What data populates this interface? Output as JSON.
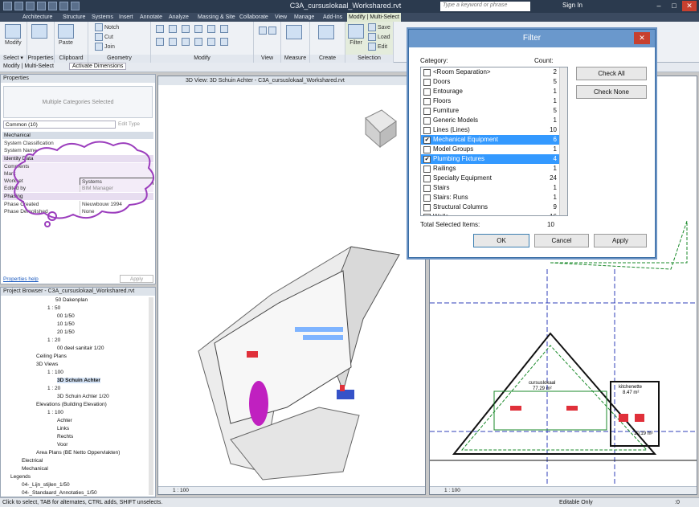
{
  "app": {
    "title": "C3A_cursuslokaal_Workshared.rvt",
    "search_placeholder": "Type a keyword or phrase",
    "signin": "Sign In"
  },
  "ribbon_tabs": [
    "Architecture",
    "Structure",
    "Systems",
    "Insert",
    "Annotate",
    "Analyze",
    "Massing & Site",
    "Collaborate",
    "View",
    "Manage",
    "Add-Ins",
    "Modify | Multi-Select"
  ],
  "ribbon": {
    "modify": "Modify",
    "paste": "Paste",
    "notch": "Notch",
    "cut": "Cut",
    "join": "Join",
    "filter": "Filter",
    "save": "Save",
    "load": "Load",
    "edit": "Edit",
    "groups": {
      "select": "Select",
      "properties": "Properties",
      "clipboard": "Clipboard",
      "geometry": "Geometry",
      "modify": "Modify",
      "view": "View",
      "measure": "Measure",
      "create": "Create",
      "selection": "Selection"
    },
    "select_dropdown": "Select ▾"
  },
  "context": {
    "label": "Modify | Multi-Select",
    "activate": "Activate Dimensions"
  },
  "properties": {
    "header": "Properties",
    "type_selector": "Multiple Categories Selected",
    "filter_value": "Common (10)",
    "edit_type": "Edit Type",
    "sections": {
      "mechanical": "Mechanical",
      "identity": "Identity Data",
      "phasing": "Phasing"
    },
    "rows": [
      {
        "k": "System Classification",
        "v": ""
      },
      {
        "k": "System Name",
        "v": ""
      },
      {
        "k": "Comments",
        "v": ""
      },
      {
        "k": "Mark",
        "v": ""
      },
      {
        "k": "Workset",
        "v": "Systems"
      },
      {
        "k": "Edited by",
        "v": "BIM Manager"
      },
      {
        "k": "Phase Created",
        "v": "Nieuwbouw 1994"
      },
      {
        "k": "Phase Demolished",
        "v": "None"
      }
    ],
    "help": "Properties help",
    "apply": "Apply"
  },
  "browser": {
    "header": "Project Browser - C3A_cursuslokaal_Workshared.rvt",
    "nodes": [
      "50 Dakenplan",
      "1 : 50",
      "00 1/50",
      "10 1/50",
      "20 1/50",
      "1 : 20",
      "00 deel sanitair 1/20",
      "Ceiling Plans",
      "3D Views",
      "1 : 100",
      "3D Schuin Achter",
      "1 : 20",
      "3D Schuin Achter 1/20",
      "Elevations (Building Elevation)",
      "1 : 100",
      "Achter",
      "Links",
      "Rechts",
      "Voor",
      "Area Plans (BE Netto Oppervlakten)",
      "Electrical",
      "Mechanical",
      "Legends",
      "04-_Lijn_stijlen_1/50",
      "04-_Standaard_Annotaties_1/50"
    ]
  },
  "view3d": {
    "title": "3D View: 3D Schuin Achter - C3A_cursuslokaal_Workshared.rvt",
    "scale": "1 : 100"
  },
  "viewplan": {
    "scale": "1 : 100",
    "room1_name": "cursuslokaal",
    "room1_area": "77.29 m²",
    "room2_name": "kitchenette",
    "room2_area": "8.47 m²",
    "room3_area": "10.19 m²"
  },
  "filter": {
    "title": "Filter",
    "category": "Category:",
    "count": "Count:",
    "rows": [
      {
        "name": "<Room Separation>",
        "count": "2",
        "checked": false,
        "hl": false
      },
      {
        "name": "Doors",
        "count": "5",
        "checked": false,
        "hl": false
      },
      {
        "name": "Entourage",
        "count": "1",
        "checked": false,
        "hl": false
      },
      {
        "name": "Floors",
        "count": "1",
        "checked": false,
        "hl": false
      },
      {
        "name": "Furniture",
        "count": "5",
        "checked": false,
        "hl": false
      },
      {
        "name": "Generic Models",
        "count": "1",
        "checked": false,
        "hl": false
      },
      {
        "name": "Lines (Lines)",
        "count": "10",
        "checked": false,
        "hl": false
      },
      {
        "name": "Mechanical Equipment",
        "count": "6",
        "checked": true,
        "hl": true
      },
      {
        "name": "Model Groups",
        "count": "1",
        "checked": false,
        "hl": false
      },
      {
        "name": "Plumbing Fixtures",
        "count": "4",
        "checked": true,
        "hl": true
      },
      {
        "name": "Railings",
        "count": "1",
        "checked": false,
        "hl": false
      },
      {
        "name": "Specialty Equipment",
        "count": "24",
        "checked": false,
        "hl": false
      },
      {
        "name": "Stairs",
        "count": "1",
        "checked": false,
        "hl": false
      },
      {
        "name": "Stairs: Runs",
        "count": "1",
        "checked": false,
        "hl": false
      },
      {
        "name": "Structural Columns",
        "count": "9",
        "checked": false,
        "hl": false
      },
      {
        "name": "Walls",
        "count": "16",
        "checked": false,
        "hl": false
      }
    ],
    "check_all": "Check All",
    "check_none": "Check None",
    "total_label": "Total Selected Items:",
    "total": "10",
    "ok": "OK",
    "cancel": "Cancel",
    "apply": "Apply"
  },
  "status": {
    "hint": "Click to select, TAB for alternates, CTRL adds, SHIFT unselects.",
    "editable": "Editable Only",
    "zero": ":0"
  }
}
